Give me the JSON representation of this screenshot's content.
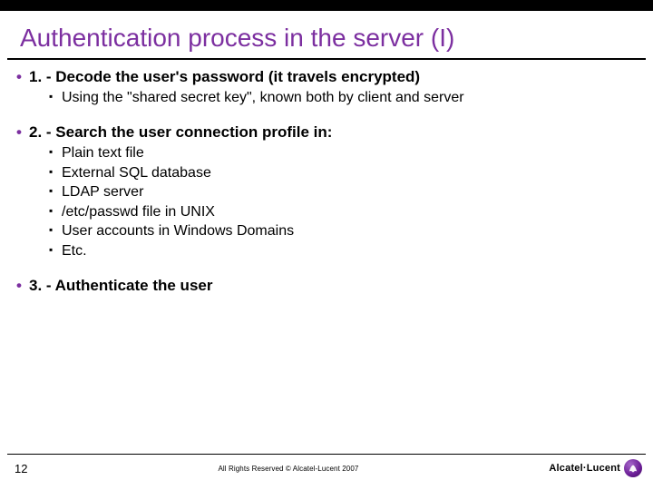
{
  "title": "Authentication process in the server (I)",
  "items": [
    {
      "heading": "1. - Decode the user's password (it travels encrypted)",
      "sub": [
        "Using the \"shared secret key\", known both by client and server"
      ]
    },
    {
      "heading": "2. - Search the user connection profile in:",
      "sub": [
        "Plain text file",
        "External SQL database",
        "LDAP server",
        "/etc/passwd file in UNIX",
        "User accounts in Windows Domains",
        "Etc."
      ]
    },
    {
      "heading": "3. - Authenticate the user",
      "sub": []
    }
  ],
  "footer": {
    "page": "12",
    "copyright": "All Rights Reserved © Alcatel-Lucent 2007",
    "brand": "Alcatel·Lucent"
  }
}
